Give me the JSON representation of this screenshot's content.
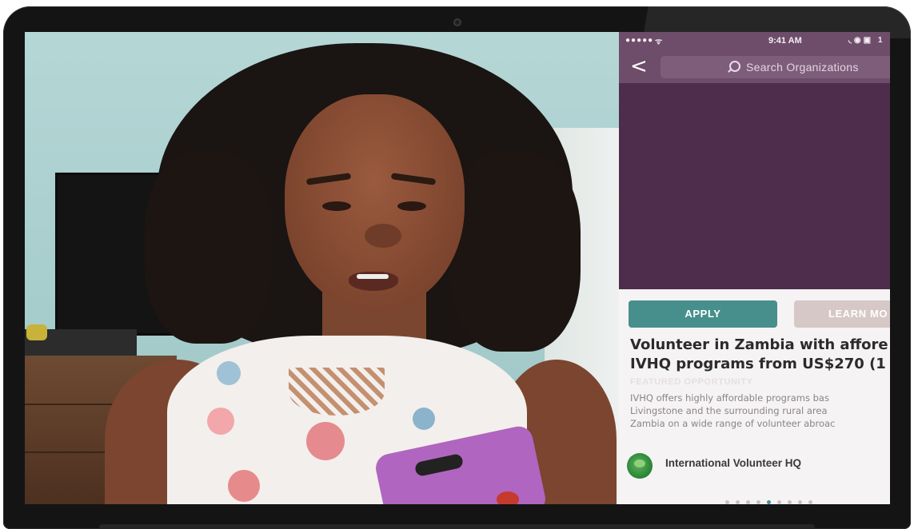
{
  "app": {
    "status_bar": {
      "signal": "●●●●●",
      "wifi": "ᯤ",
      "time": "9:41 AM",
      "right_icons": "◟◉▣ 1"
    },
    "nav": {
      "back_glyph": "<",
      "search_placeholder": "Search Organizations"
    },
    "actions": {
      "apply_label": "APPLY",
      "learn_more_label": "LEARN MO"
    },
    "opportunity": {
      "title_line1": "Volunteer in Zambia with affore",
      "title_line2": "IVHQ programs from US$270 (1",
      "tag": "FEATURED OPPORTUNITY",
      "description_lines": [
        "IVHQ offers highly affordable programs bas",
        "Livingstone and the surrounding rural area",
        "Zambia on a wide range of volunteer abroac"
      ]
    },
    "organization": {
      "name": "International Volunteer HQ"
    },
    "pager": {
      "total": 9,
      "active_index": 4
    },
    "colors": {
      "header": "#6d4d6a",
      "hero": "#4d2d4b",
      "apply": "#478f8c",
      "learn_more": "#d6c8c6",
      "pager_active": "#4c8f9c"
    }
  },
  "icons": [
    "search-icon",
    "back-chevron-icon",
    "camera-icon",
    "organization-logo-icon"
  ]
}
